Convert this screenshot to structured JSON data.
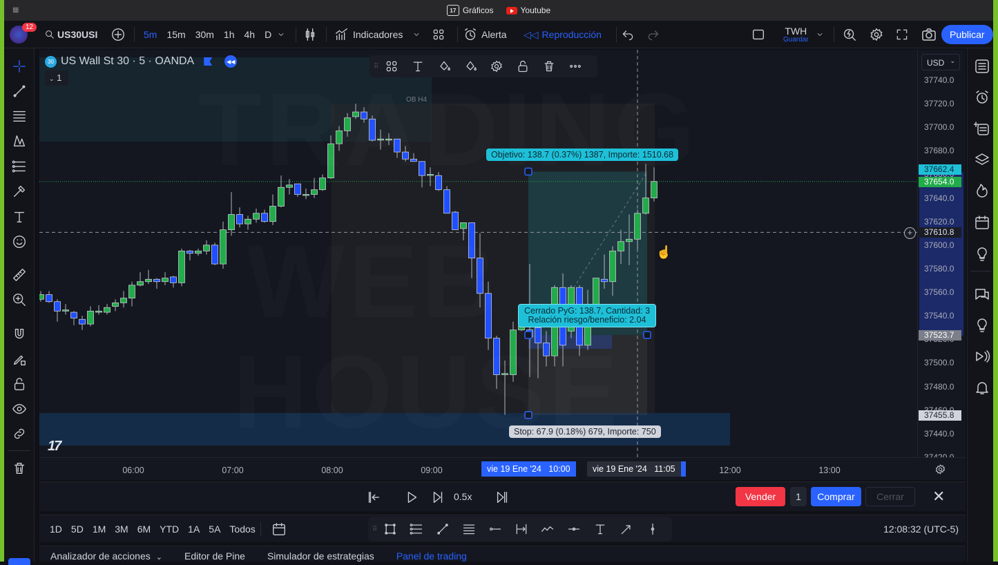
{
  "window": {
    "tabs": [
      {
        "label": "Gráficos",
        "icon": "tradingview-logo"
      },
      {
        "label": "Youtube",
        "icon": "youtube-logo"
      }
    ]
  },
  "toolbar": {
    "notifications": "12",
    "symbol": "US30USI",
    "intervals": [
      "5m",
      "15m",
      "30m",
      "1h",
      "4h",
      "D"
    ],
    "active_interval": "5m",
    "indicators_label": "Indicadores",
    "alert_label": "Alerta",
    "replay_label": "Reproducción",
    "layout_name": "TWH",
    "save_label": "Guardar",
    "publish_label": "Publicar"
  },
  "legend": {
    "badge": "30",
    "title": "US Wall St 30 · 5 · OANDA",
    "collapse_count": "1"
  },
  "chart": {
    "currency": "USD",
    "zone_label": "OB H4",
    "watermark": [
      "TRADING",
      "WEB",
      "HOUSE"
    ],
    "target_label": "Objetivo: 138.7 (0.37%) 1387, Importe: 1510.68",
    "closed_label_line1": "Cerrado PyG: 138.7, Cantidad: 3",
    "closed_label_line2": "Relación riesgo/beneficio: 2.04",
    "stop_label": "Stop: 67.9 (0.18%) 679, Importe: 750",
    "price_labels": {
      "target": "37662.4",
      "current": "37654.0",
      "crosshair": "37610.8",
      "entry": "37523.7",
      "stop": "37455.8"
    },
    "time_labels": {
      "start": "vie 19 Ene '24   10:00",
      "end": "vie 19 Ene '24   11:05"
    },
    "colors": {
      "up": "#22ab4a",
      "down": "#1f4fff",
      "accent": "#2962ff",
      "target": "#1ec0d8",
      "current": "#22ab4a"
    }
  },
  "chart_data": {
    "type": "candlestick",
    "interval": "5",
    "price_ticks": [
      "37740.0",
      "37720.0",
      "37700.0",
      "37680.0",
      "37660.0",
      "37640.0",
      "37620.0",
      "37600.0",
      "37580.0",
      "37560.0",
      "37540.0",
      "37520.0",
      "37500.0",
      "37480.0",
      "37460.0",
      "37440.0",
      "37420.0"
    ],
    "time_ticks": [
      "06:00",
      "07:00",
      "08:00",
      "09:00",
      "12:00",
      "13:00"
    ],
    "ylim": [
      37420,
      37740
    ],
    "ohlc": [
      [
        37554,
        37561,
        37552,
        37558
      ],
      [
        37558,
        37561,
        37551,
        37552
      ],
      [
        37552,
        37554,
        37535,
        37544
      ],
      [
        37544,
        37550,
        37541,
        37545
      ],
      [
        37543,
        37544,
        37532,
        37538
      ],
      [
        37537,
        37540,
        37528,
        37533
      ],
      [
        37533,
        37548,
        37531,
        37544
      ],
      [
        37543,
        37549,
        37541,
        37544
      ],
      [
        37543,
        37550,
        37541,
        37547
      ],
      [
        37548,
        37554,
        37544,
        37551
      ],
      [
        37551,
        37561,
        37547,
        37555
      ],
      [
        37555,
        37569,
        37548,
        37566
      ],
      [
        37566,
        37577,
        37565,
        37569
      ],
      [
        37569,
        37579,
        37567,
        37571
      ],
      [
        37571,
        37572,
        37563,
        37569
      ],
      [
        37569,
        37577,
        37566,
        37572
      ],
      [
        37573,
        37574,
        37564,
        37568
      ],
      [
        37568,
        37597,
        37565,
        37595
      ],
      [
        37595,
        37596,
        37587,
        37593
      ],
      [
        37593,
        37597,
        37591,
        37595
      ],
      [
        37595,
        37604,
        37592,
        37600
      ],
      [
        37600,
        37602,
        37583,
        37584
      ],
      [
        37584,
        37620,
        37580,
        37613
      ],
      [
        37613,
        37645,
        37608,
        37626
      ],
      [
        37626,
        37632,
        37615,
        37618
      ],
      [
        37618,
        37625,
        37613,
        37622
      ],
      [
        37622,
        37631,
        37619,
        37627
      ],
      [
        37627,
        37630,
        37619,
        37620
      ],
      [
        37620,
        37643,
        37617,
        37633
      ],
      [
        37633,
        37659,
        37632,
        37649
      ],
      [
        37649,
        37656,
        37643,
        37651
      ],
      [
        37652,
        37652,
        37641,
        37643
      ],
      [
        37643,
        37648,
        37639,
        37643
      ],
      [
        37643,
        37657,
        37640,
        37647
      ],
      [
        37647,
        37660,
        37646,
        37657
      ],
      [
        37657,
        37693,
        37656,
        37686
      ],
      [
        37686,
        37701,
        37680,
        37697
      ],
      [
        37697,
        37712,
        37692,
        37708
      ],
      [
        37709,
        37720,
        37707,
        37713
      ],
      [
        37713,
        37717,
        37704,
        37707
      ],
      [
        37707,
        37710,
        37688,
        37689
      ],
      [
        37690,
        37698,
        37681,
        37690
      ],
      [
        37690,
        37695,
        37685,
        37690
      ],
      [
        37690,
        37690,
        37674,
        37679
      ],
      [
        37679,
        37684,
        37671,
        37673
      ],
      [
        37673,
        37678,
        37671,
        37671
      ],
      [
        37671,
        37671,
        37649,
        37659
      ],
      [
        37660,
        37666,
        37650,
        37660
      ],
      [
        37659,
        37662,
        37646,
        37647
      ],
      [
        37647,
        37650,
        37627,
        37627
      ],
      [
        37628,
        37629,
        37613,
        37613
      ],
      [
        37614,
        37619,
        37604,
        37619
      ],
      [
        37619,
        37619,
        37572,
        37589
      ],
      [
        37589,
        37610,
        37547,
        37559
      ],
      [
        37559,
        37569,
        37511,
        37521
      ],
      [
        37521,
        37523,
        37478,
        37490
      ],
      [
        37490,
        37502,
        37456,
        37491
      ],
      [
        37490,
        37535,
        37484,
        37528
      ],
      [
        37528,
        37535,
        37527,
        37531
      ],
      [
        37528,
        37584,
        37488,
        37522
      ],
      [
        37530,
        37538,
        37487,
        37517
      ],
      [
        37517,
        37527,
        37497,
        37506
      ],
      [
        37506,
        37566,
        37497,
        37564
      ],
      [
        37564,
        37576,
        37497,
        37515
      ],
      [
        37527,
        37566,
        37521,
        37564
      ],
      [
        37564,
        37566,
        37506,
        37515
      ],
      [
        37515,
        37562,
        37511,
        37540
      ],
      [
        37548,
        37572,
        37545,
        37572
      ],
      [
        37571,
        37592,
        37563,
        37569
      ],
      [
        37569,
        37599,
        37557,
        37595
      ],
      [
        37595,
        37613,
        37584,
        37603
      ],
      [
        37603,
        37626,
        37583,
        37605
      ],
      [
        37605,
        37630,
        37596,
        37627
      ],
      [
        37627,
        37669,
        37626,
        37640
      ],
      [
        37640,
        37666,
        37637,
        37654
      ]
    ]
  },
  "replay": {
    "speed": "0.5x",
    "sell_label": "Vender",
    "quantity": "1",
    "buy_label": "Comprar",
    "close_label": "Cerrar"
  },
  "bottom": {
    "ranges": [
      "1D",
      "5D",
      "1M",
      "3M",
      "6M",
      "YTD",
      "1A",
      "5A",
      "Todos"
    ],
    "clock": "12:08:32 (UTC-5)",
    "tabs": [
      {
        "label": "Analizador de acciones",
        "active": false
      },
      {
        "label": "Editor de Pine",
        "active": false
      },
      {
        "label": "Simulador de estrategias",
        "active": false
      },
      {
        "label": "Panel de trading",
        "active": true
      }
    ]
  }
}
